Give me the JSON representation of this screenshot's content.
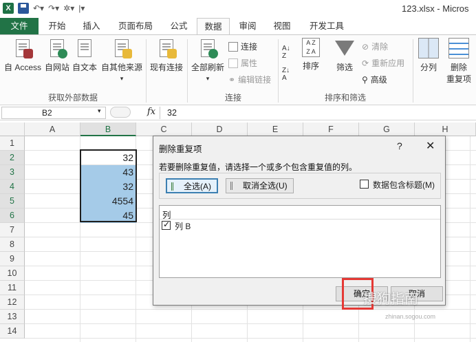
{
  "window": {
    "title": "123.xlsx - Micros"
  },
  "tabs": [
    {
      "label": "文件"
    },
    {
      "label": "开始"
    },
    {
      "label": "插入"
    },
    {
      "label": "页面布局"
    },
    {
      "label": "公式"
    },
    {
      "label": "数据",
      "active": true
    },
    {
      "label": "审阅"
    },
    {
      "label": "视图"
    },
    {
      "label": "开发工具"
    }
  ],
  "ribbon": {
    "get_external": {
      "access": "自 Access",
      "web": "自网站",
      "text": "自文本",
      "other": "自其他来源",
      "group_label": "获取外部数据"
    },
    "existing": "现有连接",
    "connections": {
      "refresh_all": "全部刷新",
      "connections": "连接",
      "properties": "属性",
      "edit_links": "编辑链接",
      "group_label": "连接"
    },
    "sort_filter": {
      "sort": "排序",
      "filter": "筛选",
      "clear": "清除",
      "reapply": "重新应用",
      "advanced": "高级",
      "group_label": "排序和筛选"
    },
    "data_tools": {
      "split": "分列",
      "delete": "删除",
      "duplicates": "重复项"
    }
  },
  "formula_bar": {
    "name_box": "B2",
    "fx": "fx",
    "value": "32"
  },
  "sheet": {
    "columns": [
      "A",
      "B",
      "C",
      "D",
      "E",
      "F",
      "G",
      "H"
    ],
    "rows": [
      "1",
      "2",
      "3",
      "4",
      "5",
      "6",
      "7",
      "8",
      "9",
      "10",
      "11",
      "12",
      "13",
      "14"
    ],
    "cells": {
      "B2": "32",
      "B3": "43",
      "B4": "32",
      "B5": "4554",
      "B6": "45"
    }
  },
  "dialog": {
    "title": "删除重复项",
    "help": "?",
    "close": "✕",
    "instruction": "若要删除重复值，请选择一个或多个包含重复值的列。",
    "select_all": "全选(A)",
    "unselect_all": "取消全选(U)",
    "has_headers": "数据包含标题(M)",
    "list_header": "列",
    "list_items": [
      {
        "label": "列 B",
        "checked": true
      }
    ],
    "ok": "确定",
    "cancel": "取消"
  },
  "watermark": {
    "text": "搜狗指南",
    "url": "zhinan.sogou.com"
  },
  "colors": {
    "excel_green": "#217346",
    "selection": "#a5cbe8",
    "highlight_box": "#e53935"
  }
}
